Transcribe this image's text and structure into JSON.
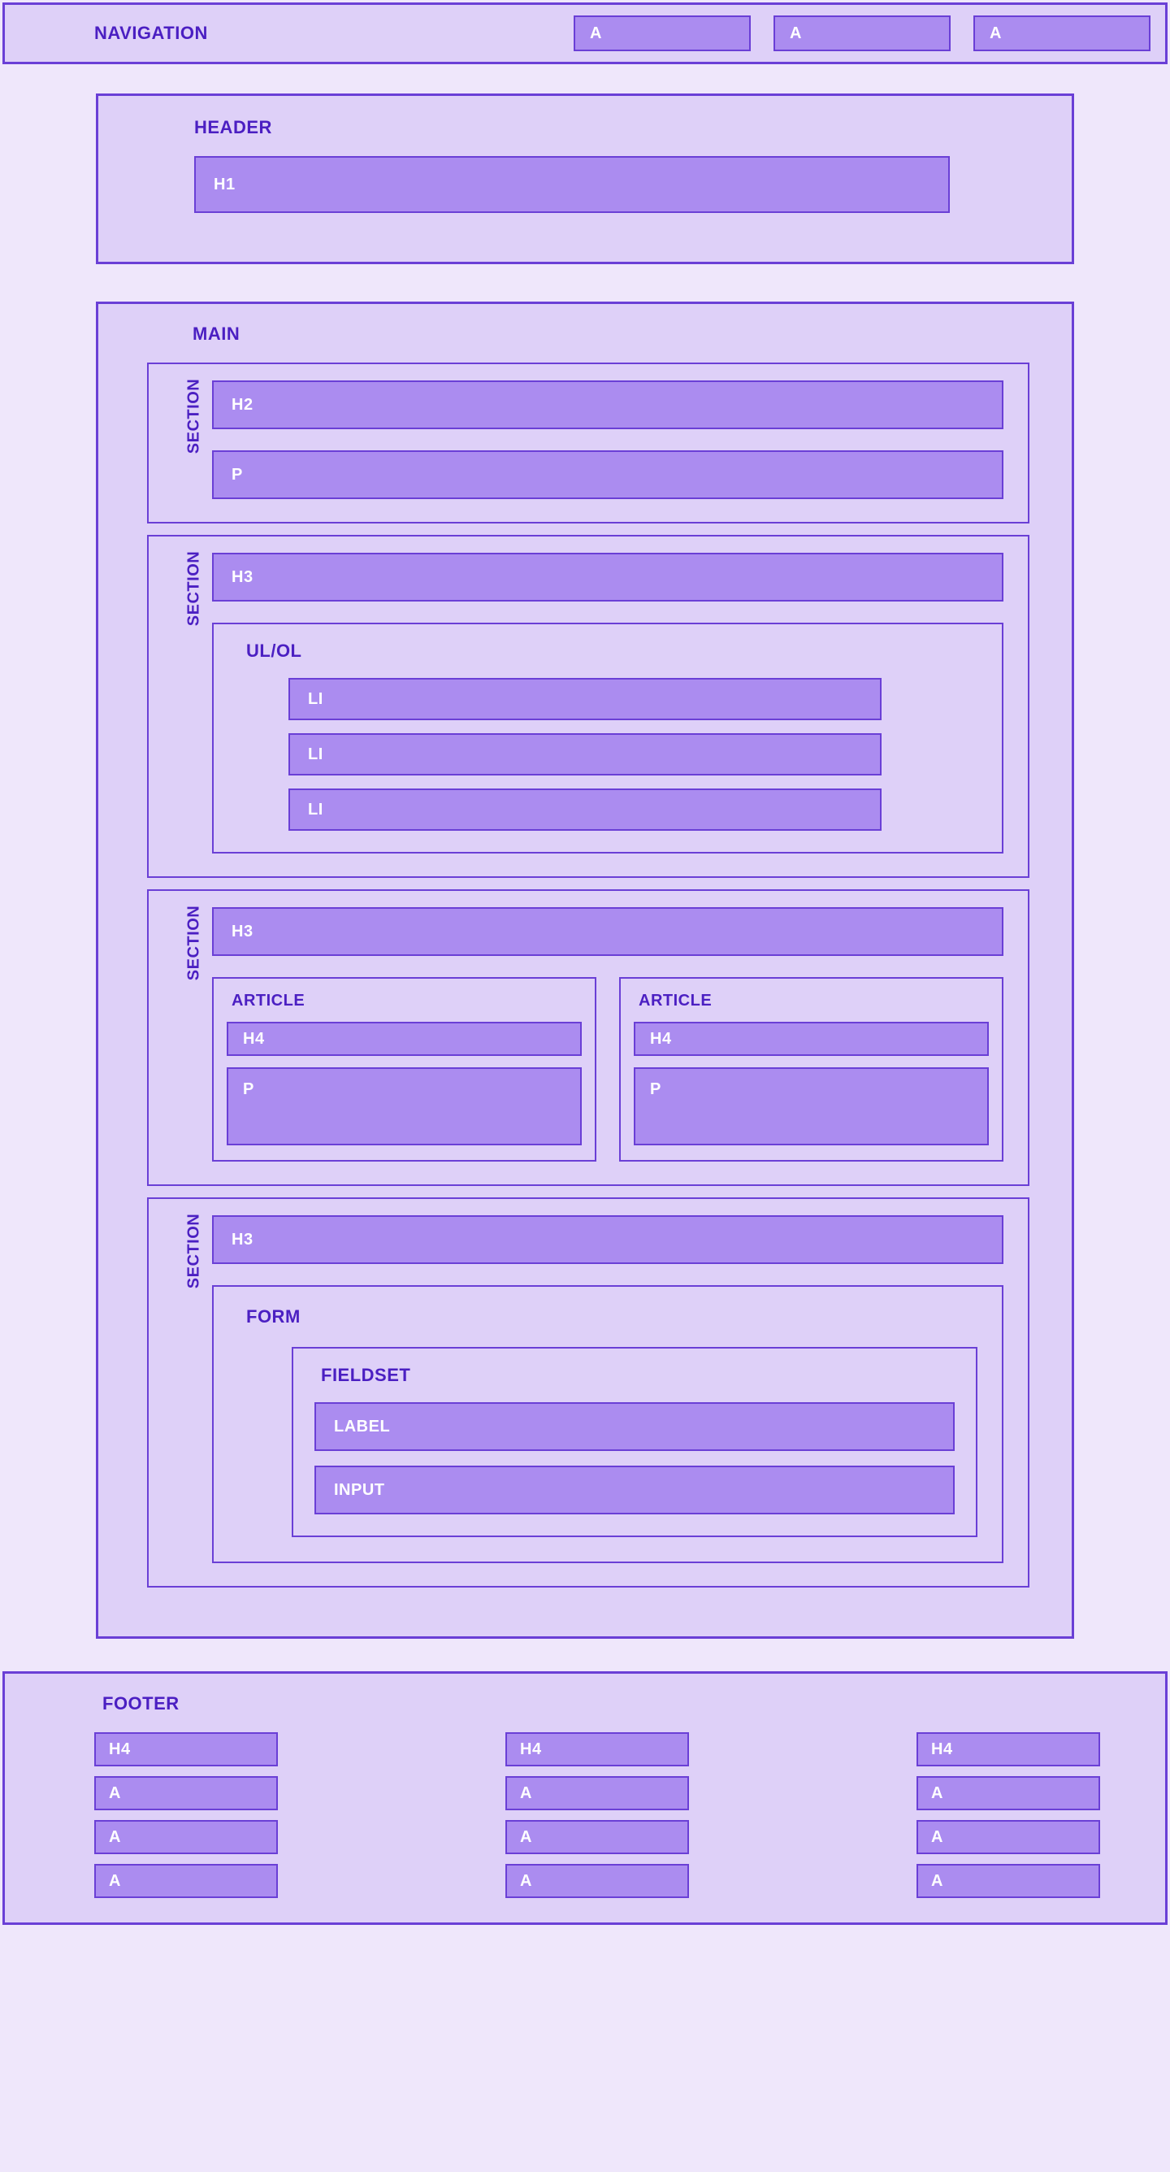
{
  "nav": {
    "label": "NAVIGATION",
    "links": [
      "A",
      "A",
      "A"
    ]
  },
  "header": {
    "label": "HEADER",
    "h1": "H1"
  },
  "main": {
    "label": "MAIN",
    "section1": {
      "label": "SECTION",
      "h2": "H2",
      "p": "P"
    },
    "section2": {
      "label": "SECTION",
      "h3": "H3",
      "ulol": {
        "label": "UL/OL",
        "items": [
          "LI",
          "LI",
          "LI"
        ]
      }
    },
    "section3": {
      "label": "SECTION",
      "h3": "H3",
      "articles": [
        {
          "label": "ARTICLE",
          "h4": "H4",
          "p": "P"
        },
        {
          "label": "ARTICLE",
          "h4": "H4",
          "p": "P"
        }
      ]
    },
    "section4": {
      "label": "SECTION",
      "h3": "H3",
      "form": {
        "label": "FORM",
        "fieldset": {
          "label": "FIELDSET",
          "labelField": "LABEL",
          "inputField": "INPUT"
        }
      }
    }
  },
  "footer": {
    "label": "FOOTER",
    "columns": [
      {
        "h4": "H4",
        "links": [
          "A",
          "A",
          "A"
        ]
      },
      {
        "h4": "H4",
        "links": [
          "A",
          "A",
          "A"
        ]
      },
      {
        "h4": "H4",
        "links": [
          "A",
          "A",
          "A"
        ]
      }
    ]
  }
}
